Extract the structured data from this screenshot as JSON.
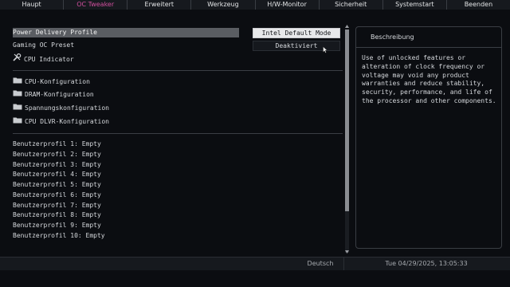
{
  "tabs": [
    {
      "label": "Haupt",
      "active": false
    },
    {
      "label": "OC Tweaker",
      "active": true
    },
    {
      "label": "Erweitert",
      "active": false
    },
    {
      "label": "Werkzeug",
      "active": false
    },
    {
      "label": "H/W-Monitor",
      "active": false
    },
    {
      "label": "Sicherheit",
      "active": false
    },
    {
      "label": "Systemstart",
      "active": false
    },
    {
      "label": "Beenden",
      "active": false
    }
  ],
  "colors": {
    "active_tab": "#d14f9e",
    "selected_row": "#5a5d62"
  },
  "settings": {
    "power_delivery_profile": {
      "label": "Power Delivery Profile",
      "value": "Intel Default Mode"
    },
    "gaming_oc_preset": {
      "label": "Gaming OC Preset",
      "value": "Deaktiviert"
    },
    "cpu_indicator": {
      "label": "CPU Indicator",
      "icon": "wrench-icon"
    }
  },
  "submenus": [
    {
      "label": "CPU-Konfiguration",
      "icon": "folder-icon"
    },
    {
      "label": "DRAM-Konfiguration",
      "icon": "folder-icon"
    },
    {
      "label": "Spannungskonfiguration",
      "icon": "folder-icon"
    },
    {
      "label": "CPU DLVR-Konfiguration",
      "icon": "folder-icon"
    }
  ],
  "profiles": [
    "Benutzerprofil 1: Empty",
    "Benutzerprofil 2: Empty",
    "Benutzerprofil 3: Empty",
    "Benutzerprofil 4: Empty",
    "Benutzerprofil 5: Empty",
    "Benutzerprofil 6: Empty",
    "Benutzerprofil 7: Empty",
    "Benutzerprofil 8: Empty",
    "Benutzerprofil 9: Empty",
    "Benutzerprofil 10: Empty"
  ],
  "description": {
    "title": "Beschreibung",
    "lines": [
      "Use of unlocked features or",
      "alteration of clock frequency or",
      "voltage may void any product",
      "warranties and reduce stability,",
      "security, performance, and life of",
      "the processor and other components."
    ]
  },
  "status": {
    "language": "Deutsch",
    "datetime": "Tue 04/29/2025, 13:05:33"
  }
}
